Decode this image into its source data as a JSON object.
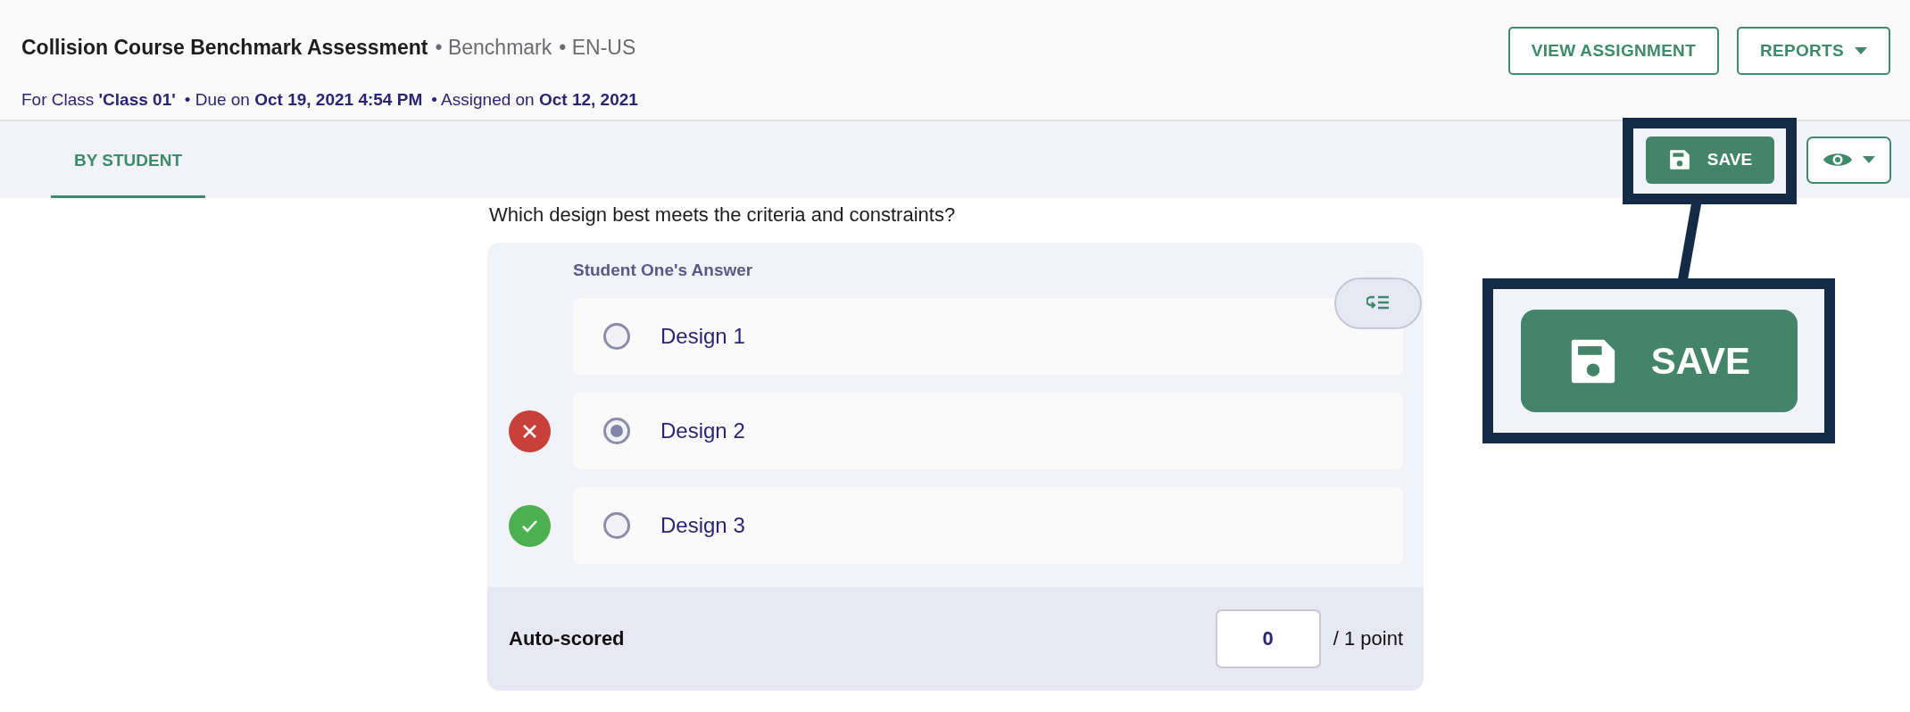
{
  "header": {
    "title": "Collision Course Benchmark Assessment",
    "tags": [
      "• Benchmark",
      "• EN-US"
    ],
    "meta": [
      "For Class **'Class 01'**",
      "• Due on **Oct 19, 2021 4:54 PM**",
      "• Assigned on **Oct 12, 2021**"
    ],
    "buttons": [
      {
        "label": "VIEW ASSIGNMENT",
        "kind": "plain"
      },
      {
        "label": "REPORTS",
        "kind": "dropdown"
      }
    ]
  },
  "tabs": [
    {
      "label": "BY STUDENT",
      "selected": true
    }
  ],
  "toolbar": {
    "save_label": "SAVE"
  },
  "callout": {
    "label": "SAVE"
  },
  "question": {
    "prompt": "Which design best meets the criteria and constraints?",
    "answer_heading": "Student One's Answer",
    "options": [
      {
        "label": "Design 1",
        "selected": false,
        "kind": "unmarked"
      },
      {
        "label": "Design 2",
        "selected": true,
        "kind": "incorrect"
      },
      {
        "label": "Design 3",
        "selected": false,
        "kind": "correct"
      }
    ],
    "footer": {
      "label": "Auto-scored",
      "score": "0",
      "max": "/ 1 point"
    }
  }
}
